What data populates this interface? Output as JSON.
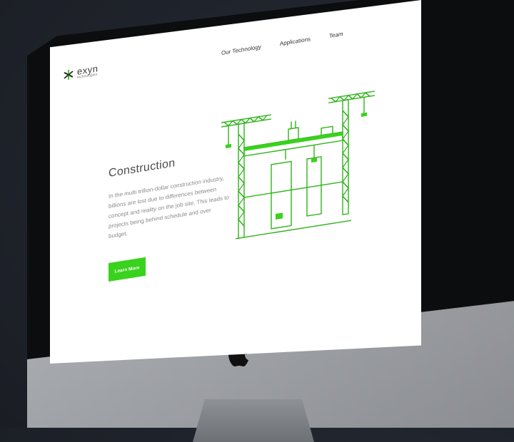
{
  "nav": {
    "items": [
      "Our Technology",
      "Applications",
      "Team"
    ]
  },
  "logo": {
    "name": "exyn",
    "tagline": "technologies"
  },
  "hero": {
    "title": "Construction",
    "body": "In the multi trillion-dollar construction industry, billions are lost due to differences between concept and reality on the job site. This leads to projects being behind schedule and over budget.",
    "cta_label": "Learn More"
  },
  "colors": {
    "accent": "#39d21c",
    "line": "#2fb31a",
    "text": "#8a8a8a"
  }
}
